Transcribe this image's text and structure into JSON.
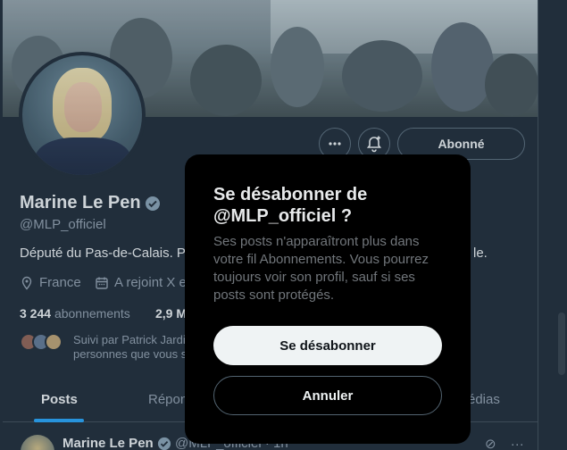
{
  "header": {
    "follow_button_label": "Abonné"
  },
  "profile": {
    "name": "Marine Le Pen",
    "handle": "@MLP_officiel",
    "bio": "Député du Pas-de-Calais. P",
    "bio_tail": "le.",
    "location": "France",
    "joined": "A rejoint X e",
    "following_count": "3 244",
    "following_label": "abonnements",
    "followers_count": "2,9 M",
    "followed_by_line1": "Suivi par Patrick Jardi",
    "followed_by_line2": "personnes que vous s"
  },
  "tabs": [
    {
      "label": "Posts"
    },
    {
      "label": "Répon"
    },
    {
      "label": "édias"
    }
  ],
  "post_preview": {
    "name": "Marine Le Pen",
    "handle": "@MLP_officiel · 1h"
  },
  "modal": {
    "title": "Se désabonner de @MLP_officiel ?",
    "text": "Ses posts n'apparaîtront plus dans votre fil Abonnements. Vous pourrez toujours voir son profil, sauf si ses posts sont protégés.",
    "confirm_label": "Se désabonner",
    "cancel_label": "Annuler"
  },
  "colors": {
    "background": "#15202b",
    "modal_background": "#000000",
    "accent": "#1d9bf0",
    "verified": "#829aab"
  }
}
